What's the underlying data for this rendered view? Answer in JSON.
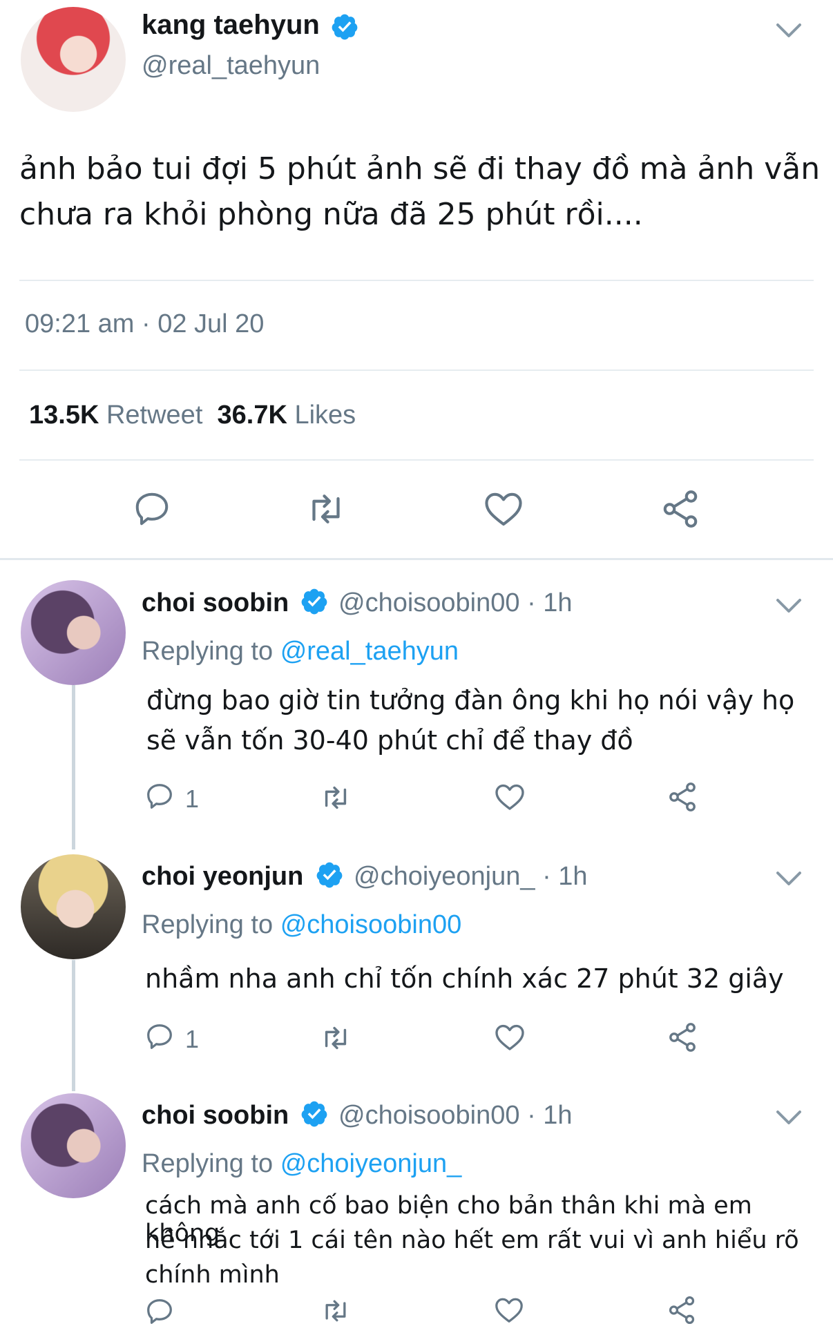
{
  "main_tweet": {
    "author_name": "kang taehyun",
    "author_handle": "@real_taehyun",
    "text": "ảnh bảo tui đợi 5 phút ảnh sẽ đi thay đồ mà ảnh vẫn chưa ra khỏi phòng nữa đã 25 phút rồi....",
    "timestamp": "09:21 am · 02 Jul 20",
    "retweets_count": "13.5K",
    "retweets_label": "Retweet",
    "likes_count": "36.7K",
    "likes_label": "Likes"
  },
  "replies": [
    {
      "author_name": "choi soobin",
      "author_handle": "@choisoobin00 · 1h",
      "replying_prefix": "Replying to",
      "replying_to": "@real_taehyun",
      "lines": [
        "đừng bao giờ tin tưởng đàn ông khi họ nói vậy họ",
        "sẽ vẫn tốn 30-40 phút chỉ để thay đồ"
      ],
      "reply_count": "1"
    },
    {
      "author_name": "choi yeonjun",
      "author_handle": "@choiyeonjun_ · 1h",
      "replying_prefix": "Replying to",
      "replying_to": "@choisoobin00",
      "lines": [
        "nhầm nha anh chỉ tốn chính xác 27 phút 32 giây"
      ],
      "reply_count": "1"
    },
    {
      "author_name": "choi soobin",
      "author_handle": "@choisoobin00 · 1h",
      "replying_prefix": "Replying to",
      "replying_to": "@choiyeonjun_",
      "lines": [
        "cách mà anh cố bao biện cho bản thân khi mà em không",
        "hề nhắc tới 1 cái tên nào hết em rất vui vì anh hiểu rõ",
        "chính mình"
      ],
      "reply_count": ""
    }
  ],
  "colors": {
    "accent": "#1da1f2",
    "secondary_text": "#657786",
    "divider": "#e6ecf0"
  },
  "icons": [
    "chevron-down-icon",
    "verified-badge-icon",
    "reply-icon",
    "retweet-icon",
    "like-icon",
    "share-icon"
  ]
}
